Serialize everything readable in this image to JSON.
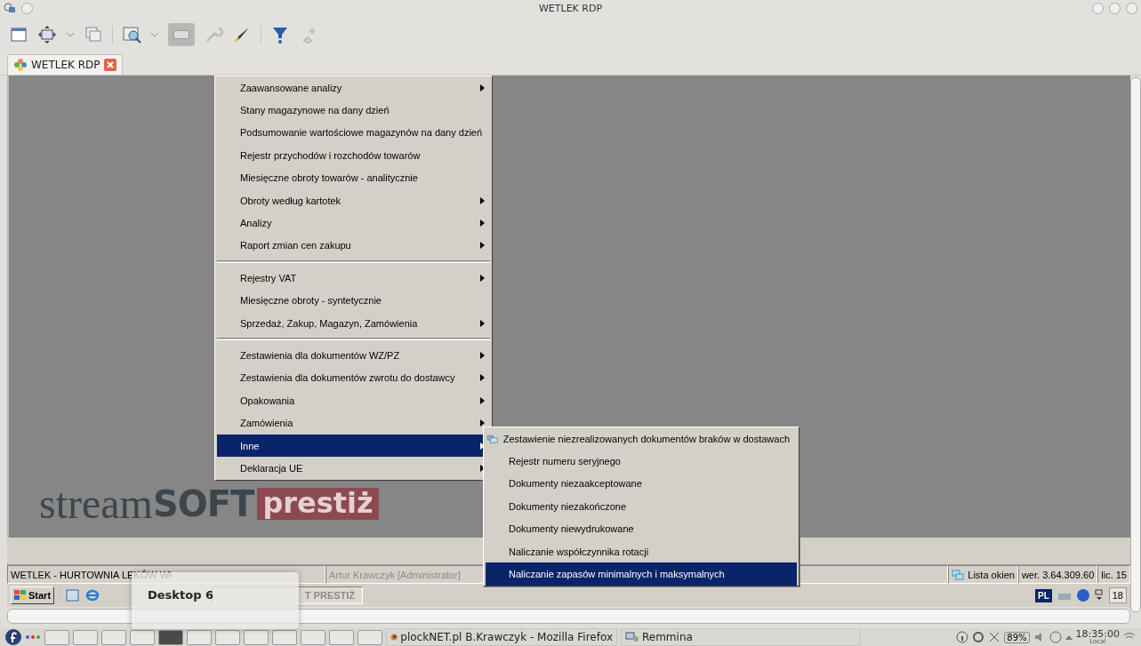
{
  "window": {
    "title": "WETLEK RDP"
  },
  "tabs": [
    {
      "label": "WETLEK RDP",
      "selected": true
    }
  ],
  "menu": {
    "items": [
      {
        "label": "Zaawansowane analizy",
        "has_submenu": true,
        "selected": false,
        "separator_before": false
      },
      {
        "label": "Stany magazynowe na dany dzień",
        "has_submenu": false,
        "selected": false,
        "separator_before": false
      },
      {
        "label": "Podsumowanie wartościowe magazynów na dany dzień",
        "has_submenu": false,
        "selected": false,
        "separator_before": false
      },
      {
        "label": "Rejestr przychodów i rozchodów towarów",
        "has_submenu": false,
        "selected": false,
        "separator_before": false
      },
      {
        "label": "Miesięczne obroty towarów - analitycznie",
        "has_submenu": false,
        "selected": false,
        "separator_before": false
      },
      {
        "label": "Obroty według kartotek",
        "has_submenu": true,
        "selected": false,
        "separator_before": false
      },
      {
        "label": "Analizy",
        "has_submenu": true,
        "selected": false,
        "separator_before": false
      },
      {
        "label": "Raport zmian cen zakupu",
        "has_submenu": true,
        "selected": false,
        "separator_before": false
      },
      {
        "label": "Rejestry VAT",
        "has_submenu": true,
        "selected": false,
        "separator_before": true
      },
      {
        "label": "Miesięczne obroty - syntetycznie",
        "has_submenu": false,
        "selected": false,
        "separator_before": false
      },
      {
        "label": "Sprzedaż, Zakup, Magazyn, Zamówienia",
        "has_submenu": true,
        "selected": false,
        "separator_before": false
      },
      {
        "label": "Zestawienia dla dokumentów WZ/PZ",
        "has_submenu": true,
        "selected": false,
        "separator_before": true
      },
      {
        "label": "Zestawienia dla dokumentów zwrotu do dostawcy",
        "has_submenu": true,
        "selected": false,
        "separator_before": false
      },
      {
        "label": "Opakowania",
        "has_submenu": true,
        "selected": false,
        "separator_before": false
      },
      {
        "label": "Zamówienia",
        "has_submenu": true,
        "selected": false,
        "separator_before": false
      },
      {
        "label": "Inne",
        "has_submenu": true,
        "selected": true,
        "separator_before": false
      },
      {
        "label": "Deklaracja UE",
        "has_submenu": true,
        "selected": false,
        "separator_before": false
      }
    ]
  },
  "submenu": {
    "items": [
      {
        "label": "Zestawienie niezrealizowanych dokumentów braków w dostawach",
        "kind": "icon",
        "selected": false
      },
      {
        "label": "Rejestr numeru seryjnego",
        "kind": "plain",
        "selected": false
      },
      {
        "label": "Dokumenty niezaakceptowane",
        "kind": "plain",
        "selected": false
      },
      {
        "label": "Dokumenty niezakończone",
        "kind": "plain",
        "selected": false
      },
      {
        "label": "Dokumenty niewydrukowane",
        "kind": "plain",
        "selected": false
      },
      {
        "label": "Naliczanie współczynnika rotacji",
        "kind": "plain",
        "selected": false
      },
      {
        "label": "Naliczanie zapasów minimalnych i maksymalnych",
        "kind": "plain",
        "selected": true
      }
    ]
  },
  "logo": {
    "part_1": "stream",
    "part_2": "SOFT",
    "part_3": "prestiż"
  },
  "status_bar": {
    "company": "WETLEK - HURTOWNIA LEKÓW Wł",
    "user": "Artur Krawczyk [Administrator]",
    "windows_button": "Lista okien",
    "version": "wer. 3.64.309.60",
    "license": "lic. 15"
  },
  "remote_taskbar": {
    "start": "Start",
    "task": "T PRESTIŻ",
    "language": "PL",
    "clock": "18"
  },
  "desktop_popup": {
    "label": "Desktop 6"
  },
  "panel": {
    "workspaces": [
      {
        "selected": false
      },
      {
        "selected": false
      },
      {
        "selected": false
      },
      {
        "selected": false
      },
      {
        "selected": true
      },
      {
        "selected": false
      },
      {
        "selected": false
      },
      {
        "selected": false
      },
      {
        "selected": false
      },
      {
        "selected": false
      },
      {
        "selected": false
      },
      {
        "selected": false
      }
    ],
    "tasks": [
      {
        "label": "plockNET.pl B.Krawczyk - Mozilla Firefox",
        "kind": "firefox",
        "selected": false
      },
      {
        "label": "Remmina",
        "kind": "remmina",
        "selected": false
      }
    ],
    "battery": "89%",
    "clock": "18:35:00",
    "clock_sub": "Local"
  }
}
